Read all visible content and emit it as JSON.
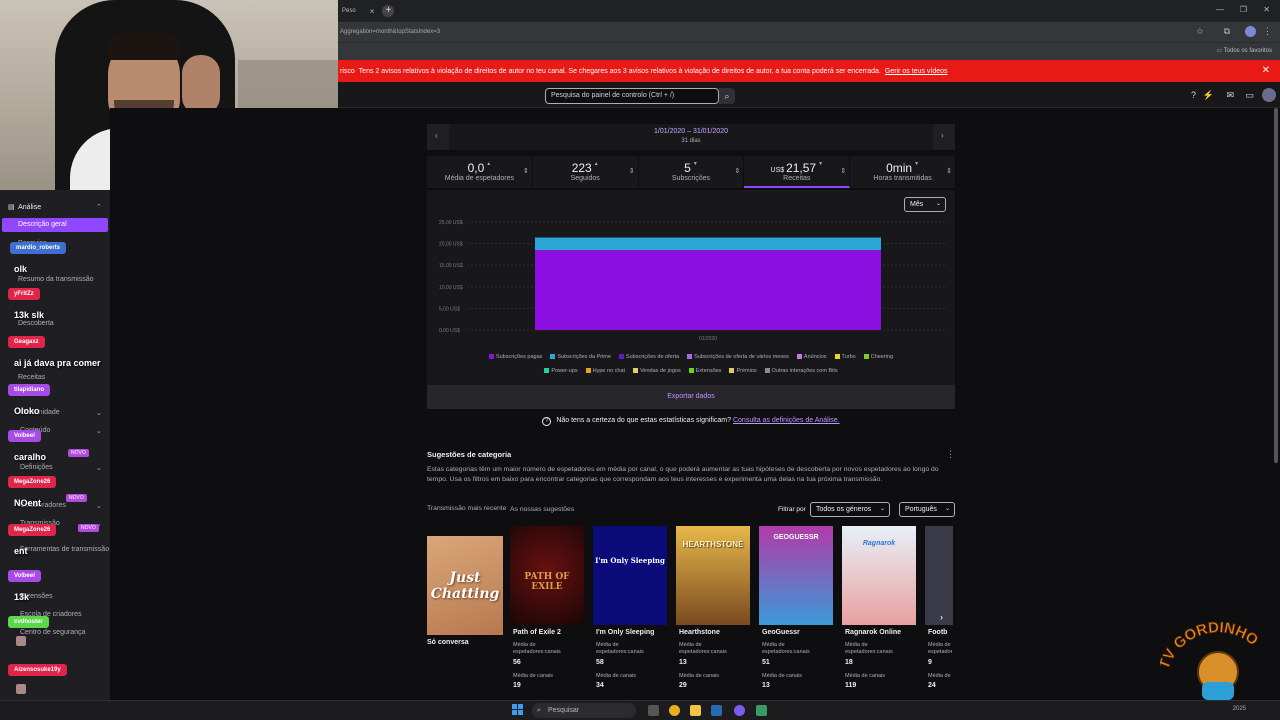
{
  "browser": {
    "tab_title": "Peso",
    "url": "Aggregation=month&topStatsIndex=3",
    "bookmarks_label": "Todos os favoritos"
  },
  "warning": {
    "prefix": "risco",
    "text": "Tens 2 avisos relativos à violação de direitos de autor no teu canal. Se chegares aos 3 avisos relativos à violação de direitos de autor, a tua conta poderá ser encerrada.",
    "link": "Gerir os teus vídeos"
  },
  "topnav": {
    "search_placeholder": "Pesquisa do painel de controlo (Ctrl + /)"
  },
  "sidebar": {
    "section": "Análise",
    "active": "Descrição geral",
    "items": [
      {
        "label": "Pesquisa",
        "top": 50
      },
      {
        "label": "Resumo da transmissão",
        "top": 86
      },
      {
        "label": "Descoberta",
        "top": 130
      },
      {
        "label": "Receitas",
        "top": 184
      }
    ],
    "other_items": [
      {
        "label": "Comunidade",
        "top": 219
      },
      {
        "label": "Conteúdo",
        "top": 237
      },
      {
        "label": "Definições",
        "top": 274
      },
      {
        "label": "Colaboradores",
        "top": 312
      },
      {
        "label": "Transmissão",
        "top": 330
      },
      {
        "label": "Ferramentas de transmissão",
        "top": 356
      },
      {
        "label": "Extensões",
        "top": 403
      },
      {
        "label": "Escola de criadores",
        "top": 421
      },
      {
        "label": "Centro de segurança",
        "top": 439
      }
    ],
    "badge": "NOVO"
  },
  "chat": [
    {
      "user": "mardio_roberts",
      "color": "#3f6fd1",
      "msg": "olk"
    },
    {
      "user": "yFritZz",
      "color": "#e0244a",
      "msg": "13k slk"
    },
    {
      "user": "Geagaxz",
      "color": "#e0244a",
      "msg": "ai já dava pra comer"
    },
    {
      "user": "tilapidiano",
      "color": "#a84ae6",
      "msg": "Oloko"
    },
    {
      "user": "Volbeel",
      "color": "#a84ae6",
      "msg": "caralho"
    },
    {
      "user": "MegaZone26",
      "color": "#e0244a",
      "msg": "NOent"
    },
    {
      "user": "MegaZone26",
      "color": "#e0244a",
      "msg": "ent"
    },
    {
      "user": "Volbeel",
      "color": "#a84ae6",
      "msg": "13k"
    },
    {
      "user": "cvdhoster",
      "color": "#5ad84a",
      "msg": ""
    },
    {
      "user": "Aizensosuke19y",
      "color": "#e0244a",
      "msg": ""
    }
  ],
  "date": {
    "range": "1/01/2020 – 31/01/2020",
    "days": "31 dias"
  },
  "stats": [
    {
      "value": "0,0",
      "unit": "",
      "label": "Média de espetadores",
      "trend": "▲"
    },
    {
      "value": "223",
      "unit": "",
      "label": "Seguidos",
      "trend": "▲"
    },
    {
      "value": "5",
      "unit": "",
      "label": "Subscrições",
      "trend": "▼"
    },
    {
      "value": "21,57",
      "unit": "US$ ",
      "label": "Receitas",
      "trend": "▼"
    },
    {
      "value": "0min",
      "unit": "",
      "label": "Horas transmitidas",
      "trend": "▼"
    }
  ],
  "period_select": "Mês",
  "export_label": "Exportar dados",
  "not_sure": {
    "text": "Não tens a certeza do que estas estatísticas significam?",
    "link": "Consulta as definições de Análise."
  },
  "chart_data": {
    "type": "bar",
    "categories": [
      "01/2020"
    ],
    "ylim": [
      0,
      25
    ],
    "yticks": [
      "0,00 US$",
      "5,00 US$",
      "10,00 US$",
      "15,00 US$",
      "20,00 US$",
      "25,00 US$"
    ],
    "series": [
      {
        "name": "Subscrições pagas",
        "color": "#8a0fe0",
        "values": [
          18.5
        ]
      },
      {
        "name": "Subscrições da Prime",
        "color": "#2aa7d6",
        "values": [
          2.9
        ]
      },
      {
        "name": "Subscrições de oferta",
        "color": "#5c1fc1",
        "values": [
          0
        ]
      },
      {
        "name": "Subscrições de oferta de vários meses",
        "color": "#b164e8",
        "values": [
          0
        ]
      },
      {
        "name": "Anúncios",
        "color": "#c17be6",
        "values": [
          0
        ]
      },
      {
        "name": "Turbo",
        "color": "#e6d61f",
        "values": [
          0
        ]
      },
      {
        "name": "Cheering",
        "color": "#7ad11f",
        "values": [
          0
        ]
      },
      {
        "name": "Power-ups",
        "color": "#1fd1a3",
        "values": [
          0
        ]
      },
      {
        "name": "Hype no chat",
        "color": "#e6a21f",
        "values": [
          0
        ]
      },
      {
        "name": "Vendas de jogos",
        "color": "#e6cd6b",
        "values": [
          0
        ]
      },
      {
        "name": "Extensões",
        "color": "#6fd11f",
        "values": [
          0
        ]
      },
      {
        "name": "Prémios",
        "color": "#e6c66b",
        "values": [
          0
        ]
      },
      {
        "name": "Outras interações com Bits",
        "color": "#8c8c8c",
        "values": [
          0
        ]
      }
    ]
  },
  "categories": {
    "title": "Sugestões de categoria",
    "desc": "Estas categorias têm um maior número de espetadores em média por canal, o que poderá aumentar as tuas hipóteses de descoberta por novos espetadores ao longo do tempo. Usa os filtros em baixo para encontrar categorias que correspondam aos teus interesses e experimenta uma delas na tua próxima transmissão.",
    "recent_title": "Transmissão mais recente",
    "ours_title": "As nossas sugestões",
    "filter_label": "Filtrar por",
    "genre": "Todos os géneros",
    "language": "Português",
    "meta_viewers": "Média de espetadores:canais",
    "meta_channels": "Média de canais",
    "recent": {
      "name": "Só conversa",
      "art": "Just Chatting"
    },
    "items": [
      {
        "name": "Path of Exile 2",
        "art": "PATH OF EXILE",
        "v1": "56",
        "v2": "19"
      },
      {
        "name": "I'm Only Sleeping",
        "art": "I'm Only Sleeping",
        "v1": "58",
        "v2": "34"
      },
      {
        "name": "Hearthstone",
        "art": "HEARTHSTONE",
        "v1": "13",
        "v2": "29"
      },
      {
        "name": "GeoGuessr",
        "art": "GEOGUESSR",
        "v1": "51",
        "v2": "13"
      },
      {
        "name": "Ragnarok Online",
        "art": "Ragnarok",
        "v1": "18",
        "v2": "119"
      },
      {
        "name": "Footb",
        "art": "",
        "v1": "9",
        "v2": "24"
      }
    ]
  },
  "taskbar": {
    "search": "Pesquisar",
    "clock": "2025"
  },
  "watermark": "TV GORDINHO"
}
